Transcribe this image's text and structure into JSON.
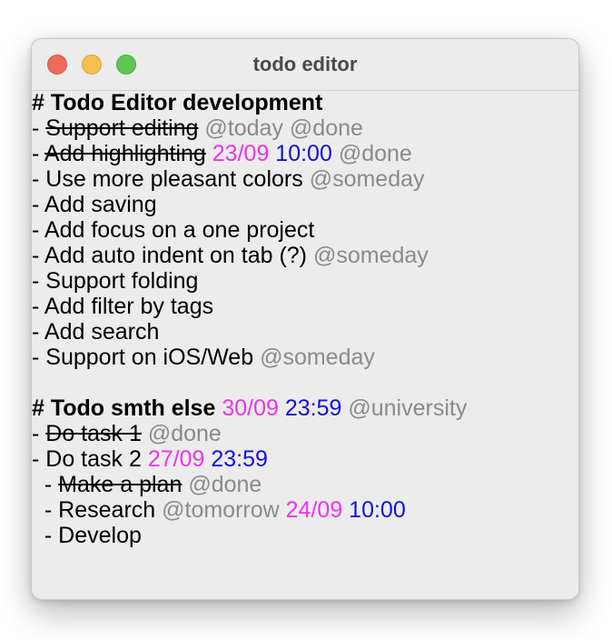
{
  "window": {
    "title": "todo editor",
    "controls": {
      "close": "close-button",
      "minimize": "minimize-button",
      "maximize": "maximize-button"
    }
  },
  "colors": {
    "tag": "#8a8a8a",
    "date": "#ea34e6",
    "time": "#1212d4",
    "text": "#000000"
  },
  "document": {
    "lines": [
      {
        "type": "heading",
        "text": "# Todo Editor development"
      },
      {
        "prefix": "- ",
        "text": "Support editing",
        "done": true,
        "tags": [
          "@today",
          "@done"
        ]
      },
      {
        "prefix": "- ",
        "text": "Add highlighting",
        "done": true,
        "date": "23/09",
        "time": "10:00",
        "tags": [
          "@done"
        ]
      },
      {
        "prefix": "- ",
        "text": "Use more pleasant colors",
        "tags": [
          "@someday"
        ]
      },
      {
        "prefix": "- ",
        "text": "Add saving"
      },
      {
        "prefix": "- ",
        "text": "Add focus on a one project"
      },
      {
        "prefix": "- ",
        "text": "Add auto indent on tab (?)",
        "tags": [
          "@someday"
        ]
      },
      {
        "prefix": "- ",
        "text": "Support folding"
      },
      {
        "prefix": "- ",
        "text": "Add filter by tags"
      },
      {
        "prefix": "- ",
        "text": "Add search"
      },
      {
        "prefix": "- ",
        "text": "Support on iOS/Web",
        "tags": [
          "@someday"
        ]
      },
      {
        "type": "blank"
      },
      {
        "type": "heading",
        "text": "# Todo smth else",
        "date": "30/09",
        "time": "23:59",
        "tags": [
          "@university"
        ]
      },
      {
        "prefix": "- ",
        "text": "Do task 1",
        "done": true,
        "tags": [
          "@done"
        ]
      },
      {
        "prefix": "- ",
        "text": "Do task 2",
        "date": "27/09",
        "time": "23:59"
      },
      {
        "prefix": "  - ",
        "text": "Make a plan",
        "done": true,
        "tags": [
          "@done"
        ]
      },
      {
        "prefix": "  - ",
        "text": "Research",
        "tags": [
          "@tomorrow"
        ],
        "date": "24/09",
        "time": "10:00",
        "order": "tags-first"
      },
      {
        "prefix": "  - ",
        "text": "Develop"
      }
    ]
  }
}
